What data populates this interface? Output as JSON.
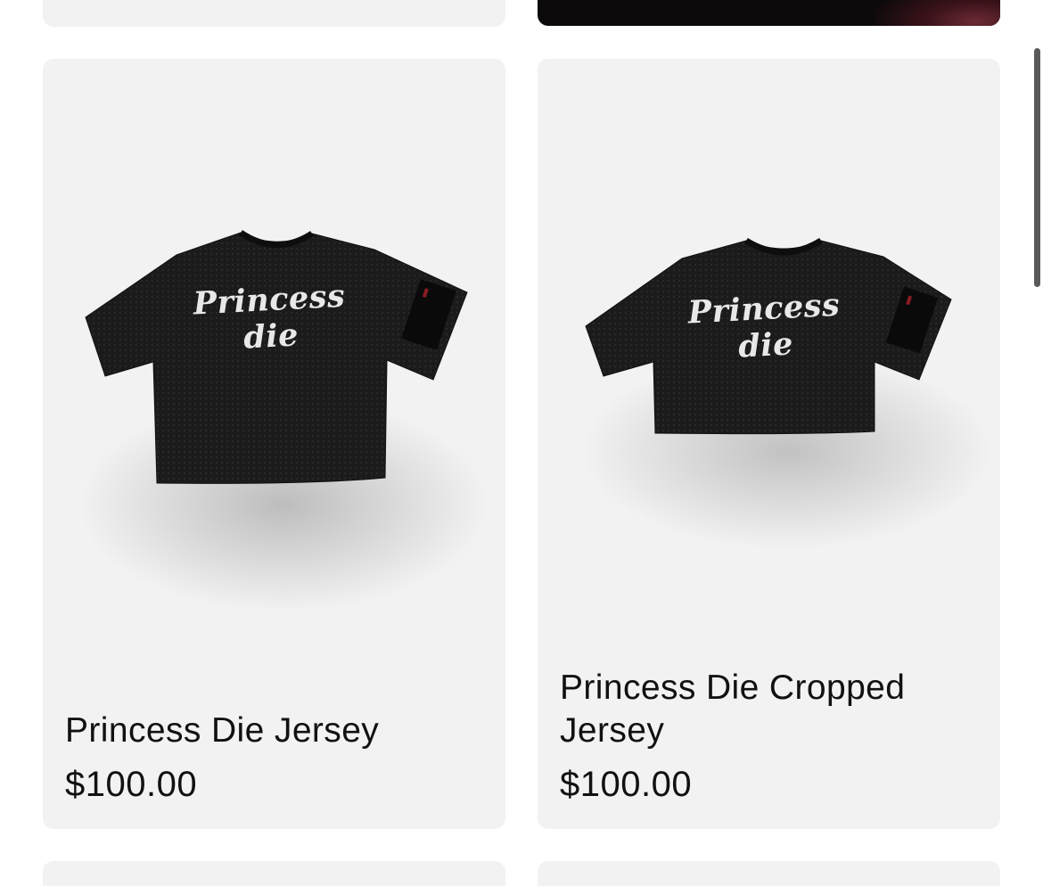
{
  "products": [
    {
      "title": "Princess Die Jersey",
      "price": "$100.00",
      "image_text": "Princess die",
      "image_alt": "Black mesh t-shirt jersey"
    },
    {
      "title": "Princess Die Cropped Jersey",
      "price": "$100.00",
      "image_text": "Princess die",
      "image_alt": "Black mesh cropped jersey"
    }
  ],
  "colors": {
    "card_background": "#f2f2f2",
    "text": "#111111",
    "garment": "#1b1b1b",
    "scrollbar_thumb": "#5a5a5a"
  }
}
